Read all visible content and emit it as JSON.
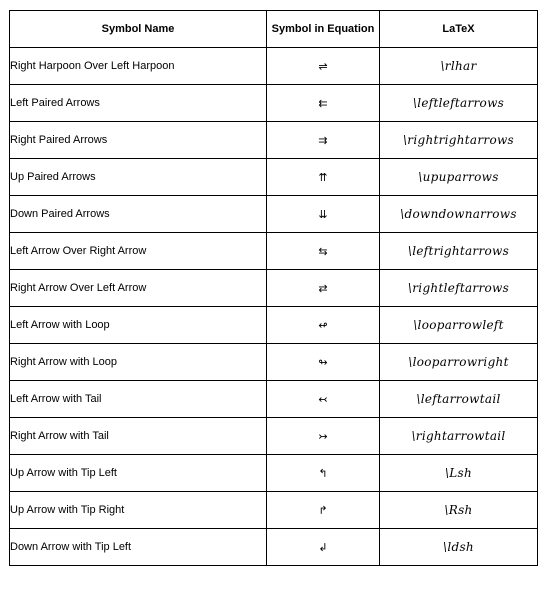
{
  "table": {
    "headers": [
      "Symbol Name",
      "Symbol in Equation",
      "LaTeX"
    ],
    "rows": [
      {
        "name": "Right Harpoon Over Left Harpoon",
        "symbol": "⇌",
        "latex": "\\rlhar"
      },
      {
        "name": "Left Paired Arrows",
        "symbol": "⇇",
        "latex": "\\leftleftarrows"
      },
      {
        "name": "Right Paired Arrows",
        "symbol": "⇉",
        "latex": "\\rightrightarrows"
      },
      {
        "name": "Up Paired Arrows",
        "symbol": "⇈",
        "latex": "\\upuparrows"
      },
      {
        "name": "Down Paired Arrows",
        "symbol": "⇊",
        "latex": "\\downdownarrows"
      },
      {
        "name": "Left Arrow Over Right Arrow",
        "symbol": "⇆",
        "latex": "\\leftrightarrows"
      },
      {
        "name": "Right Arrow Over Left Arrow",
        "symbol": "⇄",
        "latex": "\\rightleftarrows"
      },
      {
        "name": "Left Arrow with Loop",
        "symbol": "↫",
        "latex": "\\looparrowleft"
      },
      {
        "name": "Right Arrow with Loop",
        "symbol": "↬",
        "latex": "\\looparrowright"
      },
      {
        "name": "Left Arrow with Tail",
        "symbol": "↢",
        "latex": "\\leftarrowtail"
      },
      {
        "name": "Right Arrow with Tail",
        "symbol": "↣",
        "latex": "\\rightarrowtail"
      },
      {
        "name": "Up Arrow with Tip Left",
        "symbol": "↰",
        "latex": "\\Lsh"
      },
      {
        "name": "Up Arrow with Tip Right",
        "symbol": "↱",
        "latex": "\\Rsh"
      },
      {
        "name": "Down Arrow with Tip Left",
        "symbol": "↲",
        "latex": "\\ldsh"
      }
    ]
  }
}
